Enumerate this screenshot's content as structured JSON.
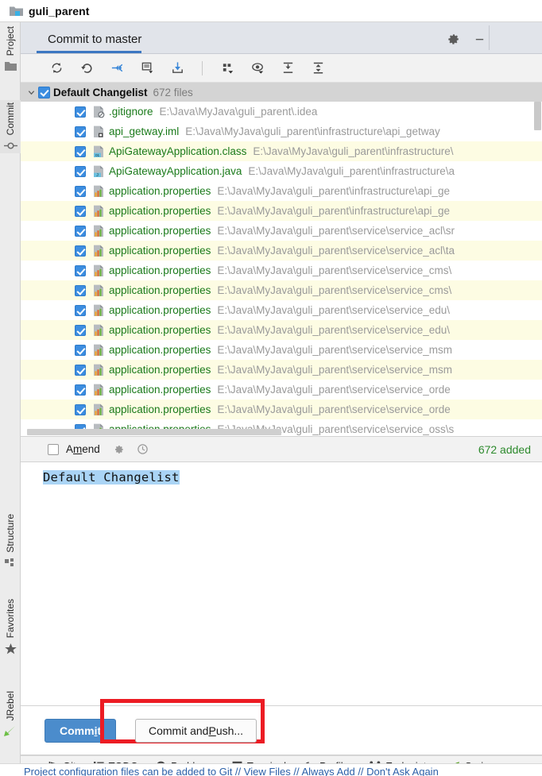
{
  "window": {
    "project_name": "guli_parent",
    "project_icon": "project-folder-icon"
  },
  "left_toolbar": {
    "items": [
      {
        "label": "Project",
        "icon": "folder-icon",
        "active": false
      },
      {
        "label": "Commit",
        "icon": "commit-icon",
        "active": true
      },
      {
        "label": "Structure",
        "icon": "structure-icon",
        "active": false
      },
      {
        "label": "Favorites",
        "icon": "star-icon",
        "active": false
      },
      {
        "label": "JRebel",
        "icon": "jrebel-icon",
        "active": false
      }
    ]
  },
  "commit_window": {
    "tab_label": "Commit to master",
    "header_actions": [
      {
        "name": "settings-gear",
        "icon": "gear-icon"
      },
      {
        "name": "minimize",
        "icon": "minimize-icon"
      }
    ],
    "toolbar": [
      {
        "name": "refresh-changes",
        "icon": "refresh-icon",
        "tooltip": "Refresh Changes"
      },
      {
        "name": "rollback",
        "icon": "rollback-icon",
        "tooltip": "Rollback"
      },
      {
        "name": "show-diff",
        "icon": "diff-icon",
        "tooltip": "Show Diff"
      },
      {
        "name": "commit-message-history",
        "icon": "message-icon",
        "tooltip": "Commit Message History"
      },
      {
        "name": "update-project",
        "icon": "update-icon",
        "tooltip": "Update Project"
      },
      {
        "name": "group-by",
        "icon": "group-by-icon",
        "tooltip": "Group By"
      },
      {
        "name": "preview-diff",
        "icon": "preview-eye-icon",
        "tooltip": "Preview Diff"
      },
      {
        "name": "expand-all",
        "icon": "expand-all-icon",
        "tooltip": "Expand All"
      },
      {
        "name": "collapse-all",
        "icon": "collapse-all-icon",
        "tooltip": "Collapse All"
      }
    ],
    "changelist": {
      "name": "Default Changelist",
      "file_count_label": "672 files",
      "checked": true,
      "expanded": true
    },
    "files": [
      {
        "name": ".gitignore",
        "path": "E:\\Java\\MyJava\\guli_parent\\.idea",
        "icon": "gitignore-file-icon",
        "checked": true,
        "alt": false
      },
      {
        "name": "api_getway.iml",
        "path": "E:\\Java\\MyJava\\guli_parent\\infrastructure\\api_getway",
        "icon": "iml-file-icon",
        "checked": true,
        "alt": false
      },
      {
        "name": "ApiGatewayApplication.class",
        "path": "E:\\Java\\MyJava\\guli_parent\\infrastructure\\",
        "icon": "class-file-icon",
        "checked": true,
        "alt": true
      },
      {
        "name": "ApiGatewayApplication.java",
        "path": "E:\\Java\\MyJava\\guli_parent\\infrastructure\\a",
        "icon": "java-file-icon",
        "checked": true,
        "alt": false
      },
      {
        "name": "application.properties",
        "path": "E:\\Java\\MyJava\\guli_parent\\infrastructure\\api_ge",
        "icon": "properties-file-icon",
        "checked": true,
        "alt": false
      },
      {
        "name": "application.properties",
        "path": "E:\\Java\\MyJava\\guli_parent\\infrastructure\\api_ge",
        "icon": "properties-file-icon",
        "checked": true,
        "alt": true
      },
      {
        "name": "application.properties",
        "path": "E:\\Java\\MyJava\\guli_parent\\service\\service_acl\\sr",
        "icon": "properties-file-icon",
        "checked": true,
        "alt": false
      },
      {
        "name": "application.properties",
        "path": "E:\\Java\\MyJava\\guli_parent\\service\\service_acl\\ta",
        "icon": "properties-file-icon",
        "checked": true,
        "alt": true
      },
      {
        "name": "application.properties",
        "path": "E:\\Java\\MyJava\\guli_parent\\service\\service_cms\\",
        "icon": "properties-file-icon",
        "checked": true,
        "alt": false
      },
      {
        "name": "application.properties",
        "path": "E:\\Java\\MyJava\\guli_parent\\service\\service_cms\\",
        "icon": "properties-file-icon",
        "checked": true,
        "alt": true
      },
      {
        "name": "application.properties",
        "path": "E:\\Java\\MyJava\\guli_parent\\service\\service_edu\\",
        "icon": "properties-file-icon",
        "checked": true,
        "alt": false
      },
      {
        "name": "application.properties",
        "path": "E:\\Java\\MyJava\\guli_parent\\service\\service_edu\\",
        "icon": "properties-file-icon",
        "checked": true,
        "alt": true
      },
      {
        "name": "application.properties",
        "path": "E:\\Java\\MyJava\\guli_parent\\service\\service_msm",
        "icon": "properties-file-icon",
        "checked": true,
        "alt": false
      },
      {
        "name": "application.properties",
        "path": "E:\\Java\\MyJava\\guli_parent\\service\\service_msm",
        "icon": "properties-file-icon",
        "checked": true,
        "alt": true
      },
      {
        "name": "application.properties",
        "path": "E:\\Java\\MyJava\\guli_parent\\service\\service_orde",
        "icon": "properties-file-icon",
        "checked": true,
        "alt": false
      },
      {
        "name": "application.properties",
        "path": "E:\\Java\\MyJava\\guli_parent\\service\\service_orde",
        "icon": "properties-file-icon",
        "checked": true,
        "alt": true
      },
      {
        "name": "application.properties",
        "path": "E:\\Java\\MyJava\\guli_parent\\service\\service_oss\\s",
        "icon": "properties-file-icon",
        "checked": true,
        "alt": false
      }
    ],
    "amend_bar": {
      "label_before": "A",
      "label_mnemonic": "m",
      "label_after": "end",
      "checked": false,
      "gear_icon": "gear-icon",
      "history_icon": "clock-icon",
      "added_text": "672 added",
      "added_color": "#2d8a2d"
    },
    "message": {
      "text": "Default Changelist",
      "selected": true,
      "selection_color": "#aad4f5"
    },
    "buttons": {
      "commit": {
        "before": "Comm",
        "mnemonic": "i",
        "after": "t",
        "full": "Commit",
        "primary": true
      },
      "commit_and_push": {
        "before": "Commit and ",
        "mnemonic": "P",
        "after": "ush...",
        "full": "Commit and Push...",
        "primary": false
      }
    },
    "highlight_box": {
      "color": "#ec1c24",
      "target": "commit-and-push-button"
    }
  },
  "status_bar": {
    "items": [
      {
        "label": "Git",
        "icon": "git-branch-icon"
      },
      {
        "label": "TODO",
        "icon": "todo-list-icon"
      },
      {
        "label": "Problems",
        "icon": "problems-icon"
      },
      {
        "label": "Terminal",
        "icon": "terminal-icon"
      },
      {
        "label": "Profiler",
        "icon": "profiler-icon"
      },
      {
        "label": "Endpoints",
        "icon": "endpoints-icon"
      },
      {
        "label": "Spring",
        "icon": "spring-leaf-icon"
      }
    ]
  },
  "notification": {
    "text": "Project configuration files can be added to Git // View Files // Always Add // Don't Ask Again"
  }
}
